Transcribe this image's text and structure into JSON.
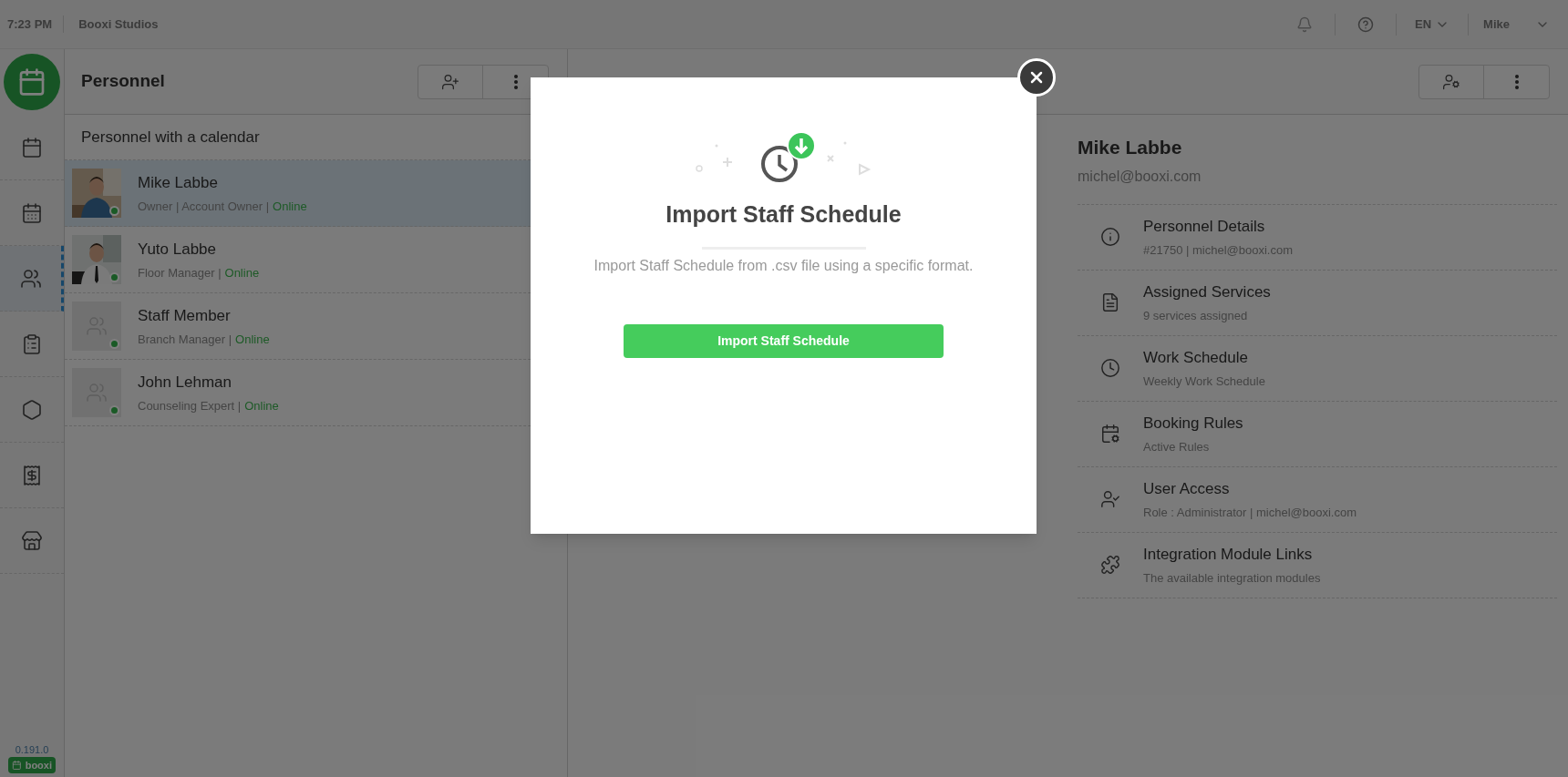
{
  "top_bar": {
    "time": "7:23 PM",
    "organization": "Booxi Studios",
    "language": "EN",
    "user": "Mike"
  },
  "sidebar": {
    "items": [
      {
        "kind": "calendar",
        "selected": false
      },
      {
        "kind": "planner",
        "selected": false
      },
      {
        "kind": "people",
        "selected": true
      },
      {
        "kind": "clipboard",
        "selected": false
      },
      {
        "kind": "hexagons",
        "selected": false
      },
      {
        "kind": "receipt",
        "selected": false
      },
      {
        "kind": "store",
        "selected": false
      }
    ],
    "version": "0.191.0",
    "brand": "booxi"
  },
  "personnel_panel": {
    "title": "Personnel",
    "section_title": "Personnel with a calendar",
    "people": [
      {
        "name": "Mike Labbe",
        "role": "Owner | Account Owner |",
        "status": "Online",
        "selected": true
      },
      {
        "name": "Yuto Labbe",
        "role": "Floor Manager |",
        "status": "Online",
        "selected": false
      },
      {
        "name": "Staff Member",
        "role": "Branch Manager |",
        "status": "Online",
        "kind": "placeholder",
        "selected": false
      },
      {
        "name": "John Lehman",
        "role": "Counseling Expert |",
        "status": "Online",
        "kind": "placeholder",
        "selected": false
      }
    ]
  },
  "details_panel": {
    "name": "Mike Labbe",
    "email": "michel@booxi.com",
    "sections": [
      {
        "kind": "info",
        "title": "Personnel Details",
        "subtitle": "#21750 | michel@booxi.com"
      },
      {
        "kind": "services",
        "title": "Assigned Services",
        "subtitle": "9 services assigned"
      },
      {
        "kind": "clock",
        "title": "Work Schedule",
        "subtitle": "Weekly Work Schedule"
      },
      {
        "kind": "rules",
        "title": "Booking Rules",
        "subtitle": "Active Rules"
      },
      {
        "kind": "access",
        "title": "User Access",
        "subtitle": "Role : Administrator | michel@booxi.com"
      },
      {
        "kind": "puzzle",
        "title": "Integration Module Links",
        "subtitle": "The available integration modules"
      }
    ]
  },
  "modal": {
    "title": "Import Staff Schedule",
    "description": "Import Staff Schedule from .csv file using a specific format.",
    "button": "Import Staff Schedule"
  }
}
